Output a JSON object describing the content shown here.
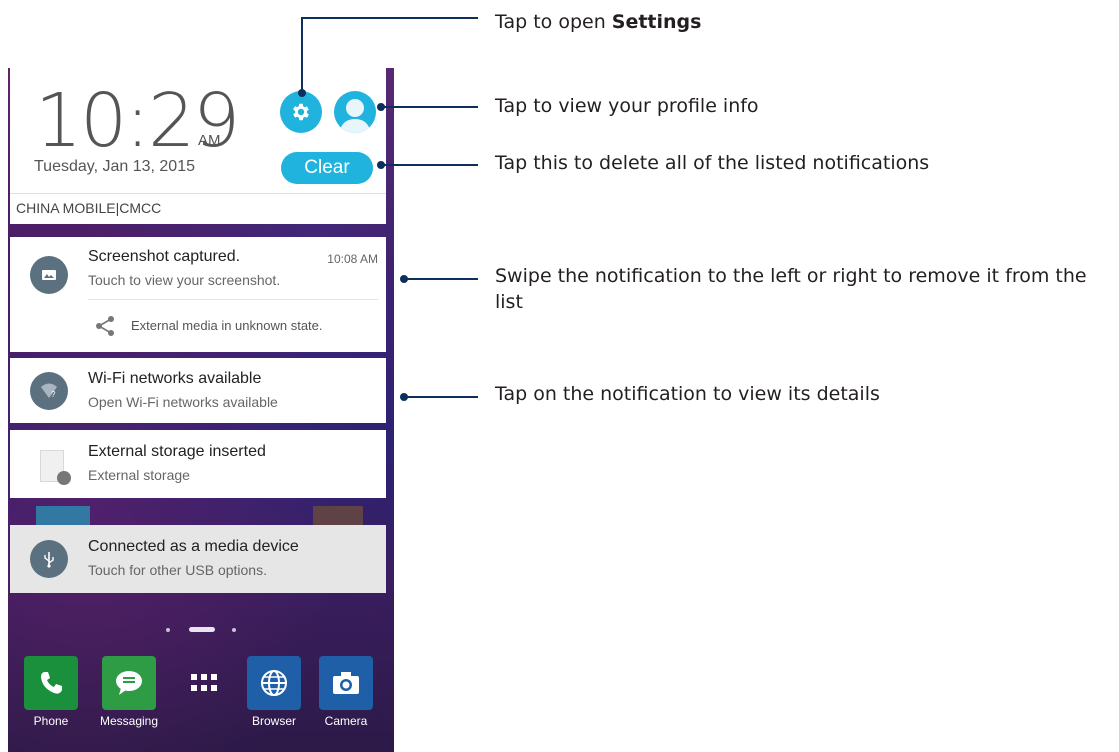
{
  "lockscreen": {
    "time": "10:29",
    "ampm": "AM",
    "date": "Tuesday, Jan 13, 2015",
    "clear_label": "Clear",
    "carrier": "CHINA MOBILE|CMCC"
  },
  "notifications": [
    {
      "title": "Screenshot captured.",
      "subtitle": "Touch to view your screenshot.",
      "time": "10:08 AM",
      "action": "External media in unknown state.",
      "icon": "image-icon"
    },
    {
      "title": "Wi-Fi networks available",
      "subtitle": "Open Wi-Fi networks available",
      "icon": "wifi-question-icon"
    },
    {
      "title": "External storage inserted",
      "subtitle": "External storage",
      "icon": "sd-card-icon"
    },
    {
      "title": "Connected as a media device",
      "subtitle": "Touch for other USB options.",
      "icon": "usb-icon"
    }
  ],
  "dock": [
    {
      "label": "Phone",
      "icon": "phone-icon",
      "color": "#1a8f3c"
    },
    {
      "label": "Messaging",
      "icon": "message-icon",
      "color": "#2e9b45"
    },
    {
      "label": "",
      "icon": "app-drawer-icon",
      "color": ""
    },
    {
      "label": "Browser",
      "icon": "globe-icon",
      "color": "#1e5fa8"
    },
    {
      "label": "Camera",
      "icon": "camera-icon",
      "color": "#1e5fa8"
    }
  ],
  "callouts": {
    "settings_prefix": "Tap to open ",
    "settings_bold": "Settings",
    "profile": "Tap to view your profile info",
    "clear": "Tap this to delete all of the listed notifications",
    "swipe": "Swipe the notification to the left or right to remove it from the list",
    "details": "Tap on the notification to view its details"
  },
  "colors": {
    "accent": "#1fb3de",
    "callout_line": "#0d2f5c"
  }
}
